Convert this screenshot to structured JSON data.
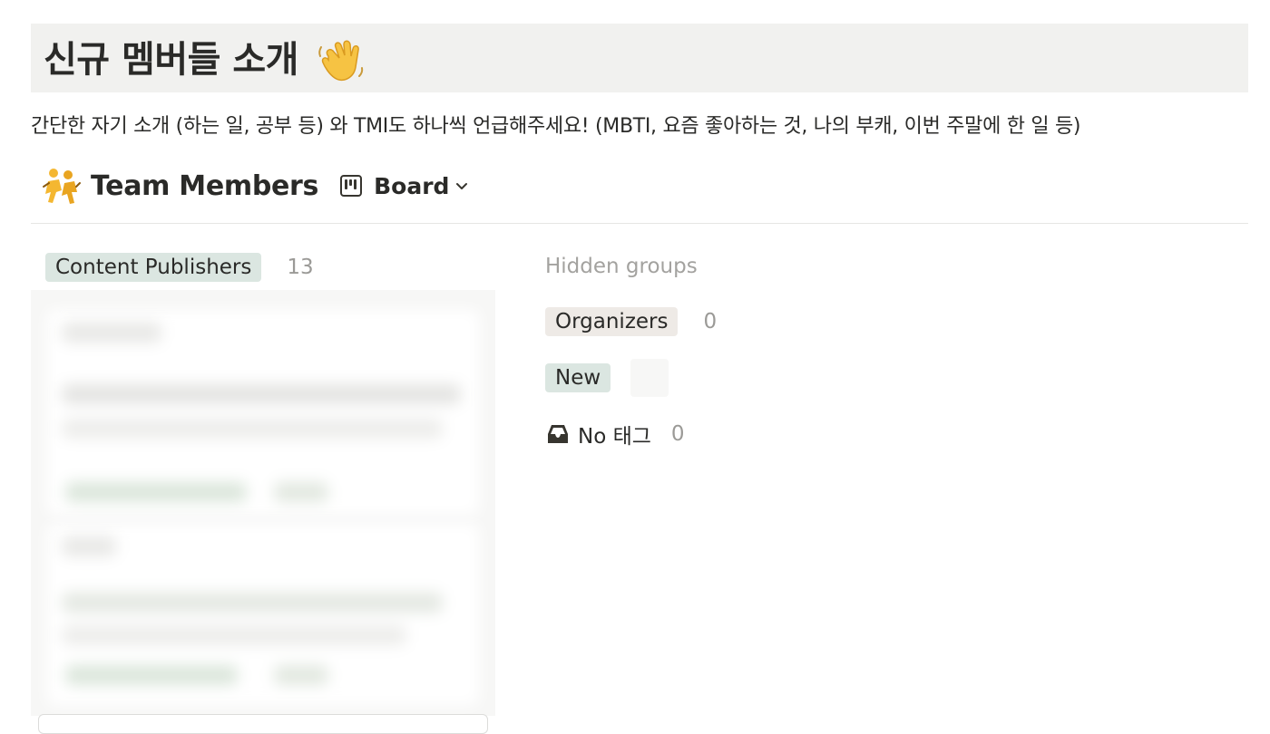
{
  "page": {
    "title": "신규 멤버들 소개",
    "title_icon": "waving-hand-icon",
    "subtitle": "간단한 자기 소개 (하는 일, 공부 등) 와 TMI도 하나씩 언급해주세요! (MBTI, 요즘 좋아하는 것, 나의 부캐, 이번 주말에 한 일 등)"
  },
  "database": {
    "icon": "team-members-icon",
    "title": "Team Members",
    "view": {
      "icon": "board-icon",
      "label": "Board",
      "dropdown_icon": "chevron-down-icon"
    }
  },
  "board": {
    "visible_group": {
      "label": "Content Publishers",
      "count": "13",
      "tag_color": "#dbe6e1"
    },
    "hidden_groups_label": "Hidden groups",
    "hidden_groups": [
      {
        "label": "Organizers",
        "count": "0",
        "tag_color": "#eeeae6"
      },
      {
        "label": "New",
        "count": "",
        "tag_color": "#dbe6e1"
      },
      {
        "label": "No 태그",
        "count": "0",
        "icon": "inbox-icon"
      }
    ]
  },
  "colors": {
    "title_bar_bg": "#f1f1ef",
    "text": "#2a2a28",
    "muted": "#9b9a97",
    "divider": "#e6e6e4"
  }
}
